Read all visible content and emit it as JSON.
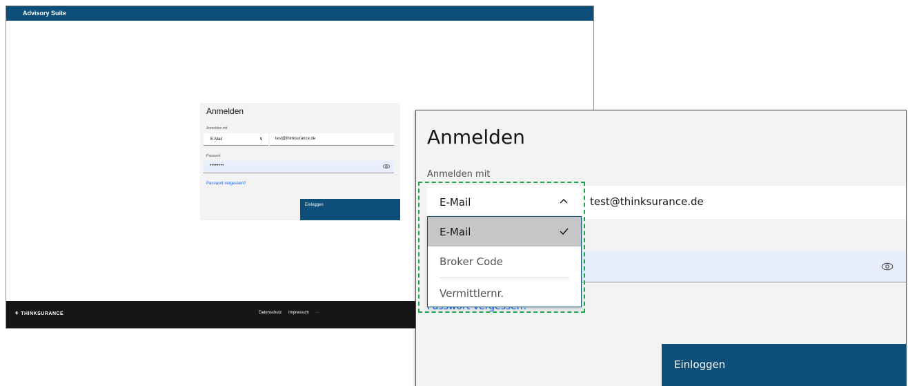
{
  "app": {
    "title": "Advisory Suite"
  },
  "background_form": {
    "title": "Anmelden",
    "login_with_label": "Anmelden mit",
    "selected_method": "E-Mail",
    "email_value": "test@thinksurance.de",
    "password_label": "Passwort",
    "password_masked": "••••••••",
    "forgot_link": "Passwort vergessen?",
    "login_button": "Einloggen"
  },
  "footer": {
    "logo": "⚘ THINKSURANCE",
    "links": [
      "Datenschutz",
      "Impressum"
    ]
  },
  "zoomed_form": {
    "title": "Anmelden",
    "login_with_label": "Anmelden mit",
    "selected_method": "E-Mail",
    "email_value": "test@thinksurance.de",
    "forgot_link": "Passwort vergessen?",
    "login_button": "Einloggen",
    "dropdown_options": [
      {
        "label": "E-Mail",
        "selected": true
      },
      {
        "label": "Broker Code",
        "selected": false
      },
      {
        "label": "Vermittlernr.",
        "selected": false
      }
    ]
  },
  "colors": {
    "brand": "#0d4f78",
    "highlight": "#1aa54a",
    "link": "#0f62fe",
    "field_active": "#e8eefc"
  }
}
